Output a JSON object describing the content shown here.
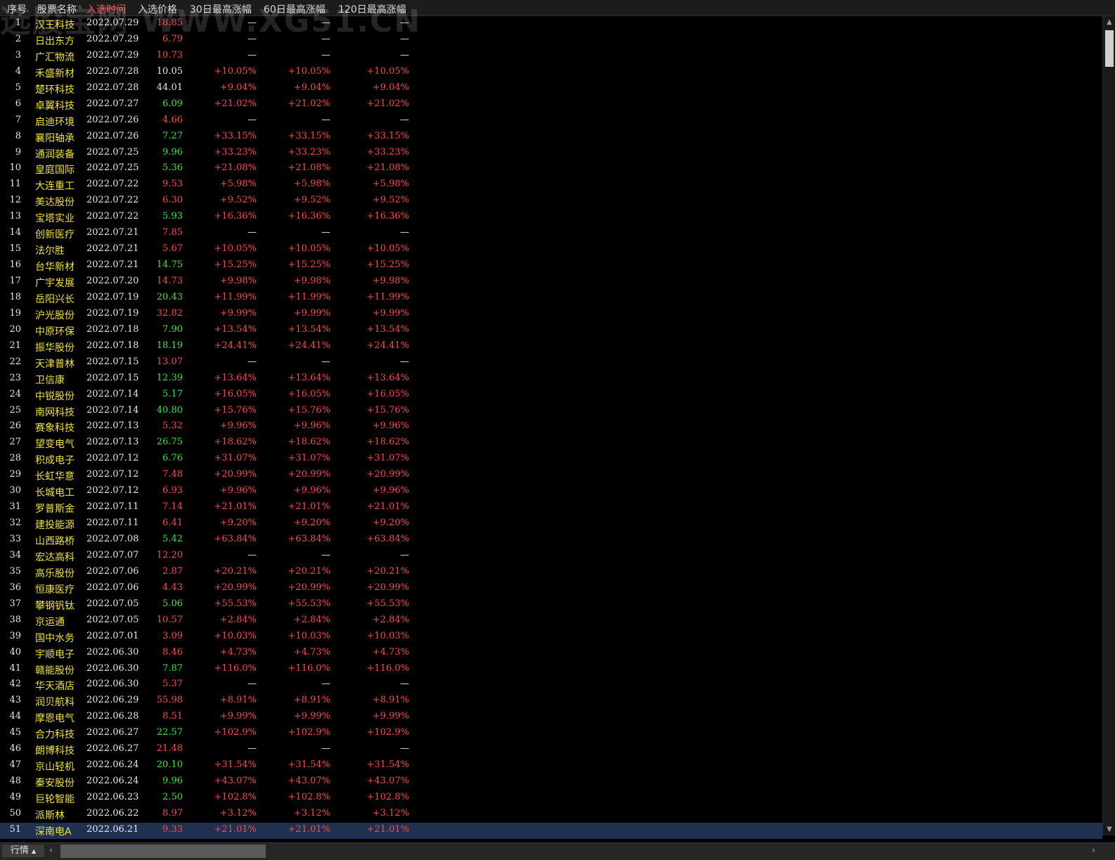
{
  "watermark": "选股宝网 WWW.XG51.CN",
  "columns": {
    "index": "序号",
    "name": "股票名称",
    "date": "入选时间",
    "price": "入选价格",
    "gain30": "30日最高涨幅",
    "gain60": "60日最高涨幅",
    "gain120": "120日最高涨幅"
  },
  "colors": {
    "up": "#ff4a4a",
    "down": "#38e838",
    "flat": "#e8e8e8",
    "name": "#f2e23c",
    "selected_row": "#1f3050"
  },
  "rows": [
    {
      "idx": "1",
      "name": "汉王科技",
      "date": "2022.07.29",
      "price": "18.85",
      "pc": "red",
      "g30": "—",
      "g60": "—",
      "g120": "—"
    },
    {
      "idx": "2",
      "name": "日出东方",
      "date": "2022.07.29",
      "price": "6.79",
      "pc": "red",
      "g30": "—",
      "g60": "—",
      "g120": "—"
    },
    {
      "idx": "3",
      "name": "广汇物流",
      "date": "2022.07.29",
      "price": "10.73",
      "pc": "red",
      "g30": "—",
      "g60": "—",
      "g120": "—"
    },
    {
      "idx": "4",
      "name": "禾盛新材",
      "date": "2022.07.28",
      "price": "10.05",
      "pc": "white",
      "g30": "+10.05%",
      "g60": "+10.05%",
      "g120": "+10.05%"
    },
    {
      "idx": "5",
      "name": "楚环科技",
      "date": "2022.07.28",
      "price": "44.01",
      "pc": "white",
      "g30": "+9.04%",
      "g60": "+9.04%",
      "g120": "+9.04%"
    },
    {
      "idx": "6",
      "name": "卓翼科技",
      "date": "2022.07.27",
      "price": "6.09",
      "pc": "green",
      "g30": "+21.02%",
      "g60": "+21.02%",
      "g120": "+21.02%"
    },
    {
      "idx": "7",
      "name": "启迪环境",
      "date": "2022.07.26",
      "price": "4.66",
      "pc": "red",
      "g30": "—",
      "g60": "—",
      "g120": "—"
    },
    {
      "idx": "8",
      "name": "襄阳轴承",
      "date": "2022.07.26",
      "price": "7.27",
      "pc": "green",
      "g30": "+33.15%",
      "g60": "+33.15%",
      "g120": "+33.15%"
    },
    {
      "idx": "9",
      "name": "通润装备",
      "date": "2022.07.25",
      "price": "9.96",
      "pc": "green",
      "g30": "+33.23%",
      "g60": "+33.23%",
      "g120": "+33.23%"
    },
    {
      "idx": "10",
      "name": "皇庭国际",
      "date": "2022.07.25",
      "price": "5.36",
      "pc": "green",
      "g30": "+21.08%",
      "g60": "+21.08%",
      "g120": "+21.08%"
    },
    {
      "idx": "11",
      "name": "大连重工",
      "date": "2022.07.22",
      "price": "9.53",
      "pc": "red",
      "g30": "+5.98%",
      "g60": "+5.98%",
      "g120": "+5.98%"
    },
    {
      "idx": "12",
      "name": "美达股份",
      "date": "2022.07.22",
      "price": "6.30",
      "pc": "red",
      "g30": "+9.52%",
      "g60": "+9.52%",
      "g120": "+9.52%"
    },
    {
      "idx": "13",
      "name": "宝塔实业",
      "date": "2022.07.22",
      "price": "5.93",
      "pc": "green",
      "g30": "+16.36%",
      "g60": "+16.36%",
      "g120": "+16.36%"
    },
    {
      "idx": "14",
      "name": "创新医疗",
      "date": "2022.07.21",
      "price": "7.85",
      "pc": "red",
      "g30": "—",
      "g60": "—",
      "g120": "—"
    },
    {
      "idx": "15",
      "name": "法尔胜",
      "date": "2022.07.21",
      "price": "5.67",
      "pc": "red",
      "g30": "+10.05%",
      "g60": "+10.05%",
      "g120": "+10.05%"
    },
    {
      "idx": "16",
      "name": "台华新材",
      "date": "2022.07.21",
      "price": "14.75",
      "pc": "green",
      "g30": "+15.25%",
      "g60": "+15.25%",
      "g120": "+15.25%"
    },
    {
      "idx": "17",
      "name": "广宇发展",
      "date": "2022.07.20",
      "price": "14.73",
      "pc": "red",
      "g30": "+9.98%",
      "g60": "+9.98%",
      "g120": "+9.98%"
    },
    {
      "idx": "18",
      "name": "岳阳兴长",
      "date": "2022.07.19",
      "price": "20.43",
      "pc": "green",
      "g30": "+11.99%",
      "g60": "+11.99%",
      "g120": "+11.99%"
    },
    {
      "idx": "19",
      "name": "沪光股份",
      "date": "2022.07.19",
      "price": "32.82",
      "pc": "red",
      "g30": "+9.99%",
      "g60": "+9.99%",
      "g120": "+9.99%"
    },
    {
      "idx": "20",
      "name": "中原环保",
      "date": "2022.07.18",
      "price": "7.90",
      "pc": "green",
      "g30": "+13.54%",
      "g60": "+13.54%",
      "g120": "+13.54%"
    },
    {
      "idx": "21",
      "name": "振华股份",
      "date": "2022.07.18",
      "price": "18.19",
      "pc": "green",
      "g30": "+24.41%",
      "g60": "+24.41%",
      "g120": "+24.41%"
    },
    {
      "idx": "22",
      "name": "天津普林",
      "date": "2022.07.15",
      "price": "13.07",
      "pc": "red",
      "g30": "—",
      "g60": "—",
      "g120": "—"
    },
    {
      "idx": "23",
      "name": "卫信康",
      "date": "2022.07.15",
      "price": "12.39",
      "pc": "green",
      "g30": "+13.64%",
      "g60": "+13.64%",
      "g120": "+13.64%"
    },
    {
      "idx": "24",
      "name": "中锐股份",
      "date": "2022.07.14",
      "price": "5.17",
      "pc": "green",
      "g30": "+16.05%",
      "g60": "+16.05%",
      "g120": "+16.05%"
    },
    {
      "idx": "25",
      "name": "南网科技",
      "date": "2022.07.14",
      "price": "40.80",
      "pc": "green",
      "g30": "+15.76%",
      "g60": "+15.76%",
      "g120": "+15.76%"
    },
    {
      "idx": "26",
      "name": "赛象科技",
      "date": "2022.07.13",
      "price": "5.32",
      "pc": "red",
      "g30": "+9.96%",
      "g60": "+9.96%",
      "g120": "+9.96%"
    },
    {
      "idx": "27",
      "name": "望变电气",
      "date": "2022.07.13",
      "price": "26.75",
      "pc": "green",
      "g30": "+18.62%",
      "g60": "+18.62%",
      "g120": "+18.62%"
    },
    {
      "idx": "28",
      "name": "积成电子",
      "date": "2022.07.12",
      "price": "6.76",
      "pc": "green",
      "g30": "+31.07%",
      "g60": "+31.07%",
      "g120": "+31.07%"
    },
    {
      "idx": "29",
      "name": "长虹华意",
      "date": "2022.07.12",
      "price": "7.48",
      "pc": "red",
      "g30": "+20.99%",
      "g60": "+20.99%",
      "g120": "+20.99%"
    },
    {
      "idx": "30",
      "name": "长城电工",
      "date": "2022.07.12",
      "price": "6.93",
      "pc": "red",
      "g30": "+9.96%",
      "g60": "+9.96%",
      "g120": "+9.96%"
    },
    {
      "idx": "31",
      "name": "罗普斯金",
      "date": "2022.07.11",
      "price": "7.14",
      "pc": "red",
      "g30": "+21.01%",
      "g60": "+21.01%",
      "g120": "+21.01%"
    },
    {
      "idx": "32",
      "name": "建投能源",
      "date": "2022.07.11",
      "price": "6.41",
      "pc": "red",
      "g30": "+9.20%",
      "g60": "+9.20%",
      "g120": "+9.20%"
    },
    {
      "idx": "33",
      "name": "山西路桥",
      "date": "2022.07.08",
      "price": "5.42",
      "pc": "green",
      "g30": "+63.84%",
      "g60": "+63.84%",
      "g120": "+63.84%"
    },
    {
      "idx": "34",
      "name": "宏达高科",
      "date": "2022.07.07",
      "price": "12.20",
      "pc": "red",
      "g30": "—",
      "g60": "—",
      "g120": "—"
    },
    {
      "idx": "35",
      "name": "高乐股份",
      "date": "2022.07.06",
      "price": "2.87",
      "pc": "red",
      "g30": "+20.21%",
      "g60": "+20.21%",
      "g120": "+20.21%"
    },
    {
      "idx": "36",
      "name": "恒康医疗",
      "date": "2022.07.06",
      "price": "4.43",
      "pc": "red",
      "g30": "+20.99%",
      "g60": "+20.99%",
      "g120": "+20.99%"
    },
    {
      "idx": "37",
      "name": "攀钢钒钛",
      "date": "2022.07.05",
      "price": "5.06",
      "pc": "green",
      "g30": "+55.53%",
      "g60": "+55.53%",
      "g120": "+55.53%"
    },
    {
      "idx": "38",
      "name": "京运通",
      "date": "2022.07.05",
      "price": "10.57",
      "pc": "red",
      "g30": "+2.84%",
      "g60": "+2.84%",
      "g120": "+2.84%"
    },
    {
      "idx": "39",
      "name": "国中水务",
      "date": "2022.07.01",
      "price": "3.09",
      "pc": "red",
      "g30": "+10.03%",
      "g60": "+10.03%",
      "g120": "+10.03%"
    },
    {
      "idx": "40",
      "name": "宇顺电子",
      "date": "2022.06.30",
      "price": "8.46",
      "pc": "red",
      "g30": "+4.73%",
      "g60": "+4.73%",
      "g120": "+4.73%"
    },
    {
      "idx": "41",
      "name": "赣能股份",
      "date": "2022.06.30",
      "price": "7.87",
      "pc": "green",
      "g30": "+116.0%",
      "g60": "+116.0%",
      "g120": "+116.0%"
    },
    {
      "idx": "42",
      "name": "华天酒店",
      "date": "2022.06.30",
      "price": "5.37",
      "pc": "red",
      "g30": "—",
      "g60": "—",
      "g120": "—"
    },
    {
      "idx": "43",
      "name": "润贝航科",
      "date": "2022.06.29",
      "price": "55.98",
      "pc": "red",
      "g30": "+8.91%",
      "g60": "+8.91%",
      "g120": "+8.91%"
    },
    {
      "idx": "44",
      "name": "摩恩电气",
      "date": "2022.06.28",
      "price": "8.51",
      "pc": "red",
      "g30": "+9.99%",
      "g60": "+9.99%",
      "g120": "+9.99%"
    },
    {
      "idx": "45",
      "name": "合力科技",
      "date": "2022.06.27",
      "price": "22.57",
      "pc": "green",
      "g30": "+102.9%",
      "g60": "+102.9%",
      "g120": "+102.9%"
    },
    {
      "idx": "46",
      "name": "朗博科技",
      "date": "2022.06.27",
      "price": "21.48",
      "pc": "red",
      "g30": "—",
      "g60": "—",
      "g120": "—"
    },
    {
      "idx": "47",
      "name": "京山轻机",
      "date": "2022.06.24",
      "price": "20.10",
      "pc": "green",
      "g30": "+31.54%",
      "g60": "+31.54%",
      "g120": "+31.54%"
    },
    {
      "idx": "48",
      "name": "秦安股份",
      "date": "2022.06.24",
      "price": "9.96",
      "pc": "green",
      "g30": "+43.07%",
      "g60": "+43.07%",
      "g120": "+43.07%"
    },
    {
      "idx": "49",
      "name": "巨轮智能",
      "date": "2022.06.23",
      "price": "2.50",
      "pc": "green",
      "g30": "+102.8%",
      "g60": "+102.8%",
      "g120": "+102.8%"
    },
    {
      "idx": "50",
      "name": "派斯林",
      "date": "2022.06.22",
      "price": "8.97",
      "pc": "red",
      "g30": "+3.12%",
      "g60": "+3.12%",
      "g120": "+3.12%"
    },
    {
      "idx": "51",
      "name": "深南电A",
      "date": "2022.06.21",
      "price": "9.33",
      "pc": "red",
      "g30": "+21.01%",
      "g60": "+21.01%",
      "g120": "+21.01%",
      "selected": true
    }
  ],
  "bottom": {
    "tab_label": "行情",
    "tab_icon": "caret-up-icon",
    "scroll_left_icon": "chevron-left-icon",
    "scroll_right_icon": "chevron-right-icon"
  },
  "vscroll": {
    "up_icon": "chevron-up-icon",
    "down_icon": "chevron-down-icon"
  }
}
